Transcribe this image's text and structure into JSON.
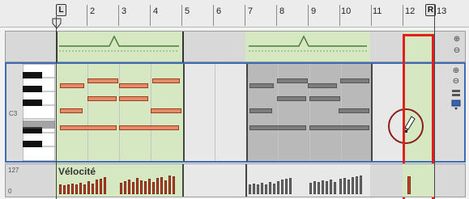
{
  "ruler": {
    "bars": [
      "2",
      "3",
      "4",
      "5",
      "6",
      "7",
      "8",
      "9",
      "10",
      "11",
      "12",
      "13"
    ],
    "left_locator": "L",
    "right_locator": "R"
  },
  "note_lane": {
    "pitch_label": "C3"
  },
  "velocity_lane": {
    "title": "Vélocité",
    "max_value": "127",
    "min_value": "0"
  },
  "colors": {
    "accent_selection": "#e02020",
    "lane_outline": "#3f6db3",
    "note_fill": "#e58a66",
    "note_muted": "#7c7c7c",
    "active_zone": "#d6e8c2"
  },
  "icons": [
    "zoom-in-icon",
    "zoom-out-icon",
    "pencil-icon",
    "folding-icon",
    "note-color-icon"
  ]
}
